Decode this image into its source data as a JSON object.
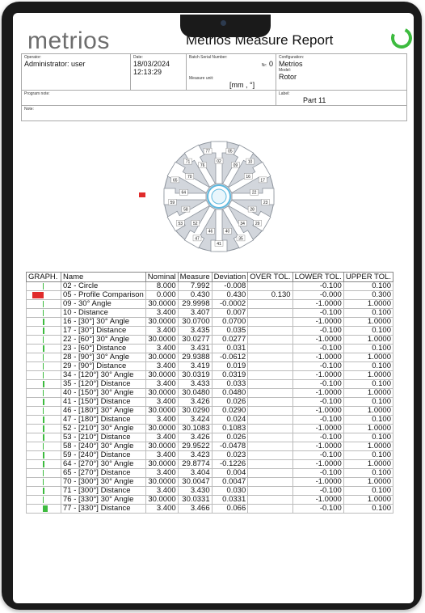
{
  "report": {
    "brand": "metrios",
    "title": "Metrios Measure Report"
  },
  "info": {
    "operator_label": "Operator:",
    "operator": "Administrator: user",
    "date_label": "Date:",
    "date": "18/03/2024",
    "time": "12:13:29",
    "batch_label": "Batch Serial Number:",
    "nr_label": "Nr:",
    "nr": "0",
    "config_label": "Configuration:",
    "config": "Metrios",
    "model_label": "Model:",
    "model": "Rotor",
    "unit_label": "Measure unit:",
    "unit": "[mm , °]",
    "program_note_label": "Program note:",
    "label_label": "Label:",
    "label": "Part 11",
    "note_label": "Note:"
  },
  "colors": {
    "accent": "#3dbb3f",
    "bad": "#e02b2b"
  },
  "drawing_labels": [
    "02",
    "05",
    "09",
    "10",
    "16",
    "17",
    "22",
    "23",
    "28",
    "29",
    "34",
    "35",
    "40",
    "41",
    "46",
    "47",
    "52",
    "53",
    "58",
    "59",
    "64",
    "65",
    "70",
    "71",
    "76",
    "77"
  ],
  "table": {
    "headers": [
      "GRAPH.",
      "Name",
      "Nominal",
      "Measure",
      "Deviation",
      "OVER TOL.",
      "LOWER TOL.",
      "UPPER TOL."
    ],
    "rows": [
      {
        "status": "ok",
        "name": "02 - Circle",
        "nominal": "8.000",
        "measure": "7.992",
        "deviation": "-0.008",
        "over": "",
        "lower": "-0.100",
        "upper": "0.100"
      },
      {
        "status": "out",
        "name": "05 - Profile Comparison",
        "nominal": "0.000",
        "measure": "0.430",
        "deviation": "0.430",
        "over": "0.130",
        "lower": "-0.000",
        "upper": "0.300"
      },
      {
        "status": "ok",
        "name": "09 - 30° Angle",
        "nominal": "30.0000",
        "measure": "29.9998",
        "deviation": "-0.0002",
        "over": "",
        "lower": "-1.0000",
        "upper": "1.0000"
      },
      {
        "status": "ok",
        "name": "10 - Distance",
        "nominal": "3.400",
        "measure": "3.407",
        "deviation": "0.007",
        "over": "",
        "lower": "-0.100",
        "upper": "0.100"
      },
      {
        "status": "ok",
        "name": "16 - [30°] 30° Angle",
        "nominal": "30.0000",
        "measure": "30.0700",
        "deviation": "0.0700",
        "over": "",
        "lower": "-1.0000",
        "upper": "1.0000"
      },
      {
        "status": "ok",
        "name": "17 - [30°] Distance",
        "nominal": "3.400",
        "measure": "3.435",
        "deviation": "0.035",
        "over": "",
        "lower": "-0.100",
        "upper": "0.100"
      },
      {
        "status": "ok",
        "name": "22 - [60°] 30° Angle",
        "nominal": "30.0000",
        "measure": "30.0277",
        "deviation": "0.0277",
        "over": "",
        "lower": "-1.0000",
        "upper": "1.0000"
      },
      {
        "status": "ok",
        "name": "23 - [60°] Distance",
        "nominal": "3.400",
        "measure": "3.431",
        "deviation": "0.031",
        "over": "",
        "lower": "-0.100",
        "upper": "0.100"
      },
      {
        "status": "ok",
        "name": "28 - [90°] 30° Angle",
        "nominal": "30.0000",
        "measure": "29.9388",
        "deviation": "-0.0612",
        "over": "",
        "lower": "-1.0000",
        "upper": "1.0000"
      },
      {
        "status": "ok",
        "name": "29 - [90°] Distance",
        "nominal": "3.400",
        "measure": "3.419",
        "deviation": "0.019",
        "over": "",
        "lower": "-0.100",
        "upper": "0.100"
      },
      {
        "status": "ok",
        "name": "34 - [120°] 30° Angle",
        "nominal": "30.0000",
        "measure": "30.0319",
        "deviation": "0.0319",
        "over": "",
        "lower": "-1.0000",
        "upper": "1.0000"
      },
      {
        "status": "ok",
        "name": "35 - [120°] Distance",
        "nominal": "3.400",
        "measure": "3.433",
        "deviation": "0.033",
        "over": "",
        "lower": "-0.100",
        "upper": "0.100"
      },
      {
        "status": "ok",
        "name": "40 - [150°] 30° Angle",
        "nominal": "30.0000",
        "measure": "30.0480",
        "deviation": "0.0480",
        "over": "",
        "lower": "-1.0000",
        "upper": "1.0000"
      },
      {
        "status": "ok",
        "name": "41 - [150°] Distance",
        "nominal": "3.400",
        "measure": "3.426",
        "deviation": "0.026",
        "over": "",
        "lower": "-0.100",
        "upper": "0.100"
      },
      {
        "status": "ok",
        "name": "46 - [180°] 30° Angle",
        "nominal": "30.0000",
        "measure": "30.0290",
        "deviation": "0.0290",
        "over": "",
        "lower": "-1.0000",
        "upper": "1.0000"
      },
      {
        "status": "ok",
        "name": "47 - [180°] Distance",
        "nominal": "3.400",
        "measure": "3.424",
        "deviation": "0.024",
        "over": "",
        "lower": "-0.100",
        "upper": "0.100"
      },
      {
        "status": "ok",
        "name": "52 - [210°] 30° Angle",
        "nominal": "30.0000",
        "measure": "30.1083",
        "deviation": "0.1083",
        "over": "",
        "lower": "-1.0000",
        "upper": "1.0000"
      },
      {
        "status": "ok",
        "name": "53 - [210°] Distance",
        "nominal": "3.400",
        "measure": "3.426",
        "deviation": "0.026",
        "over": "",
        "lower": "-0.100",
        "upper": "0.100"
      },
      {
        "status": "ok",
        "name": "58 - [240°] 30° Angle",
        "nominal": "30.0000",
        "measure": "29.9522",
        "deviation": "-0.0478",
        "over": "",
        "lower": "-1.0000",
        "upper": "1.0000"
      },
      {
        "status": "ok",
        "name": "59 - [240°] Distance",
        "nominal": "3.400",
        "measure": "3.423",
        "deviation": "0.023",
        "over": "",
        "lower": "-0.100",
        "upper": "0.100"
      },
      {
        "status": "ok",
        "name": "64 - [270°] 30° Angle",
        "nominal": "30.0000",
        "measure": "29.8774",
        "deviation": "-0.1226",
        "over": "",
        "lower": "-1.0000",
        "upper": "1.0000"
      },
      {
        "status": "ok",
        "name": "65 - [270°] Distance",
        "nominal": "3.400",
        "measure": "3.404",
        "deviation": "0.004",
        "over": "",
        "lower": "-0.100",
        "upper": "0.100"
      },
      {
        "status": "ok",
        "name": "70 - [300°] 30° Angle",
        "nominal": "30.0000",
        "measure": "30.0047",
        "deviation": "0.0047",
        "over": "",
        "lower": "-1.0000",
        "upper": "1.0000"
      },
      {
        "status": "ok",
        "name": "71 - [300°] Distance",
        "nominal": "3.400",
        "measure": "3.430",
        "deviation": "0.030",
        "over": "",
        "lower": "-0.100",
        "upper": "0.100"
      },
      {
        "status": "ok",
        "name": "76 - [330°] 30° Angle",
        "nominal": "30.0000",
        "measure": "30.0331",
        "deviation": "0.0331",
        "over": "",
        "lower": "-1.0000",
        "upper": "1.0000"
      },
      {
        "status": "ok",
        "name": "77 - [330°] Distance",
        "nominal": "3.400",
        "measure": "3.466",
        "deviation": "0.066",
        "over": "",
        "lower": "-0.100",
        "upper": "0.100"
      }
    ]
  }
}
